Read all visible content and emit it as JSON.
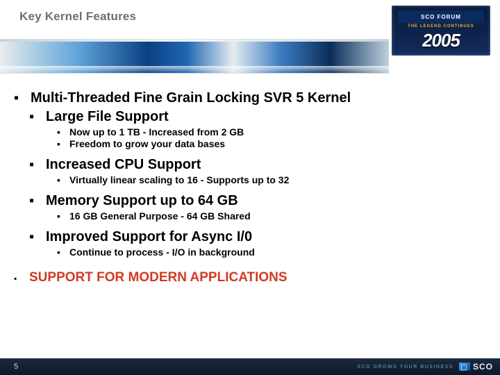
{
  "header": {
    "title": "Key Kernel Features",
    "forum": {
      "top": "SCO FORUM",
      "tag": "THE LEGEND CONTINUES",
      "year": "2005"
    }
  },
  "content": {
    "h1": "Multi-Threaded Fine Grain Locking SVR 5 Kernel",
    "s1": {
      "title": "Large File Support",
      "items": [
        "Now up to 1 TB - Increased from 2 GB",
        "Freedom to grow your data bases"
      ]
    },
    "s2": {
      "title": "Increased CPU Support",
      "items": [
        "Virtually  linear scaling to 16 - Supports up to 32"
      ]
    },
    "s3": {
      "title": "Memory Support up to 64 GB",
      "items": [
        "16 GB General Purpose - 64 GB Shared"
      ]
    },
    "s4": {
      "title": "Improved Support for Async I/0",
      "items": [
        "Continue to process - I/O in background"
      ]
    },
    "final": "SUPPORT FOR MODERN APPLICATIONS"
  },
  "footer": {
    "page": "5",
    "tagline": "SCO GROWS YOUR BUSINESS",
    "brand": "SCO"
  }
}
